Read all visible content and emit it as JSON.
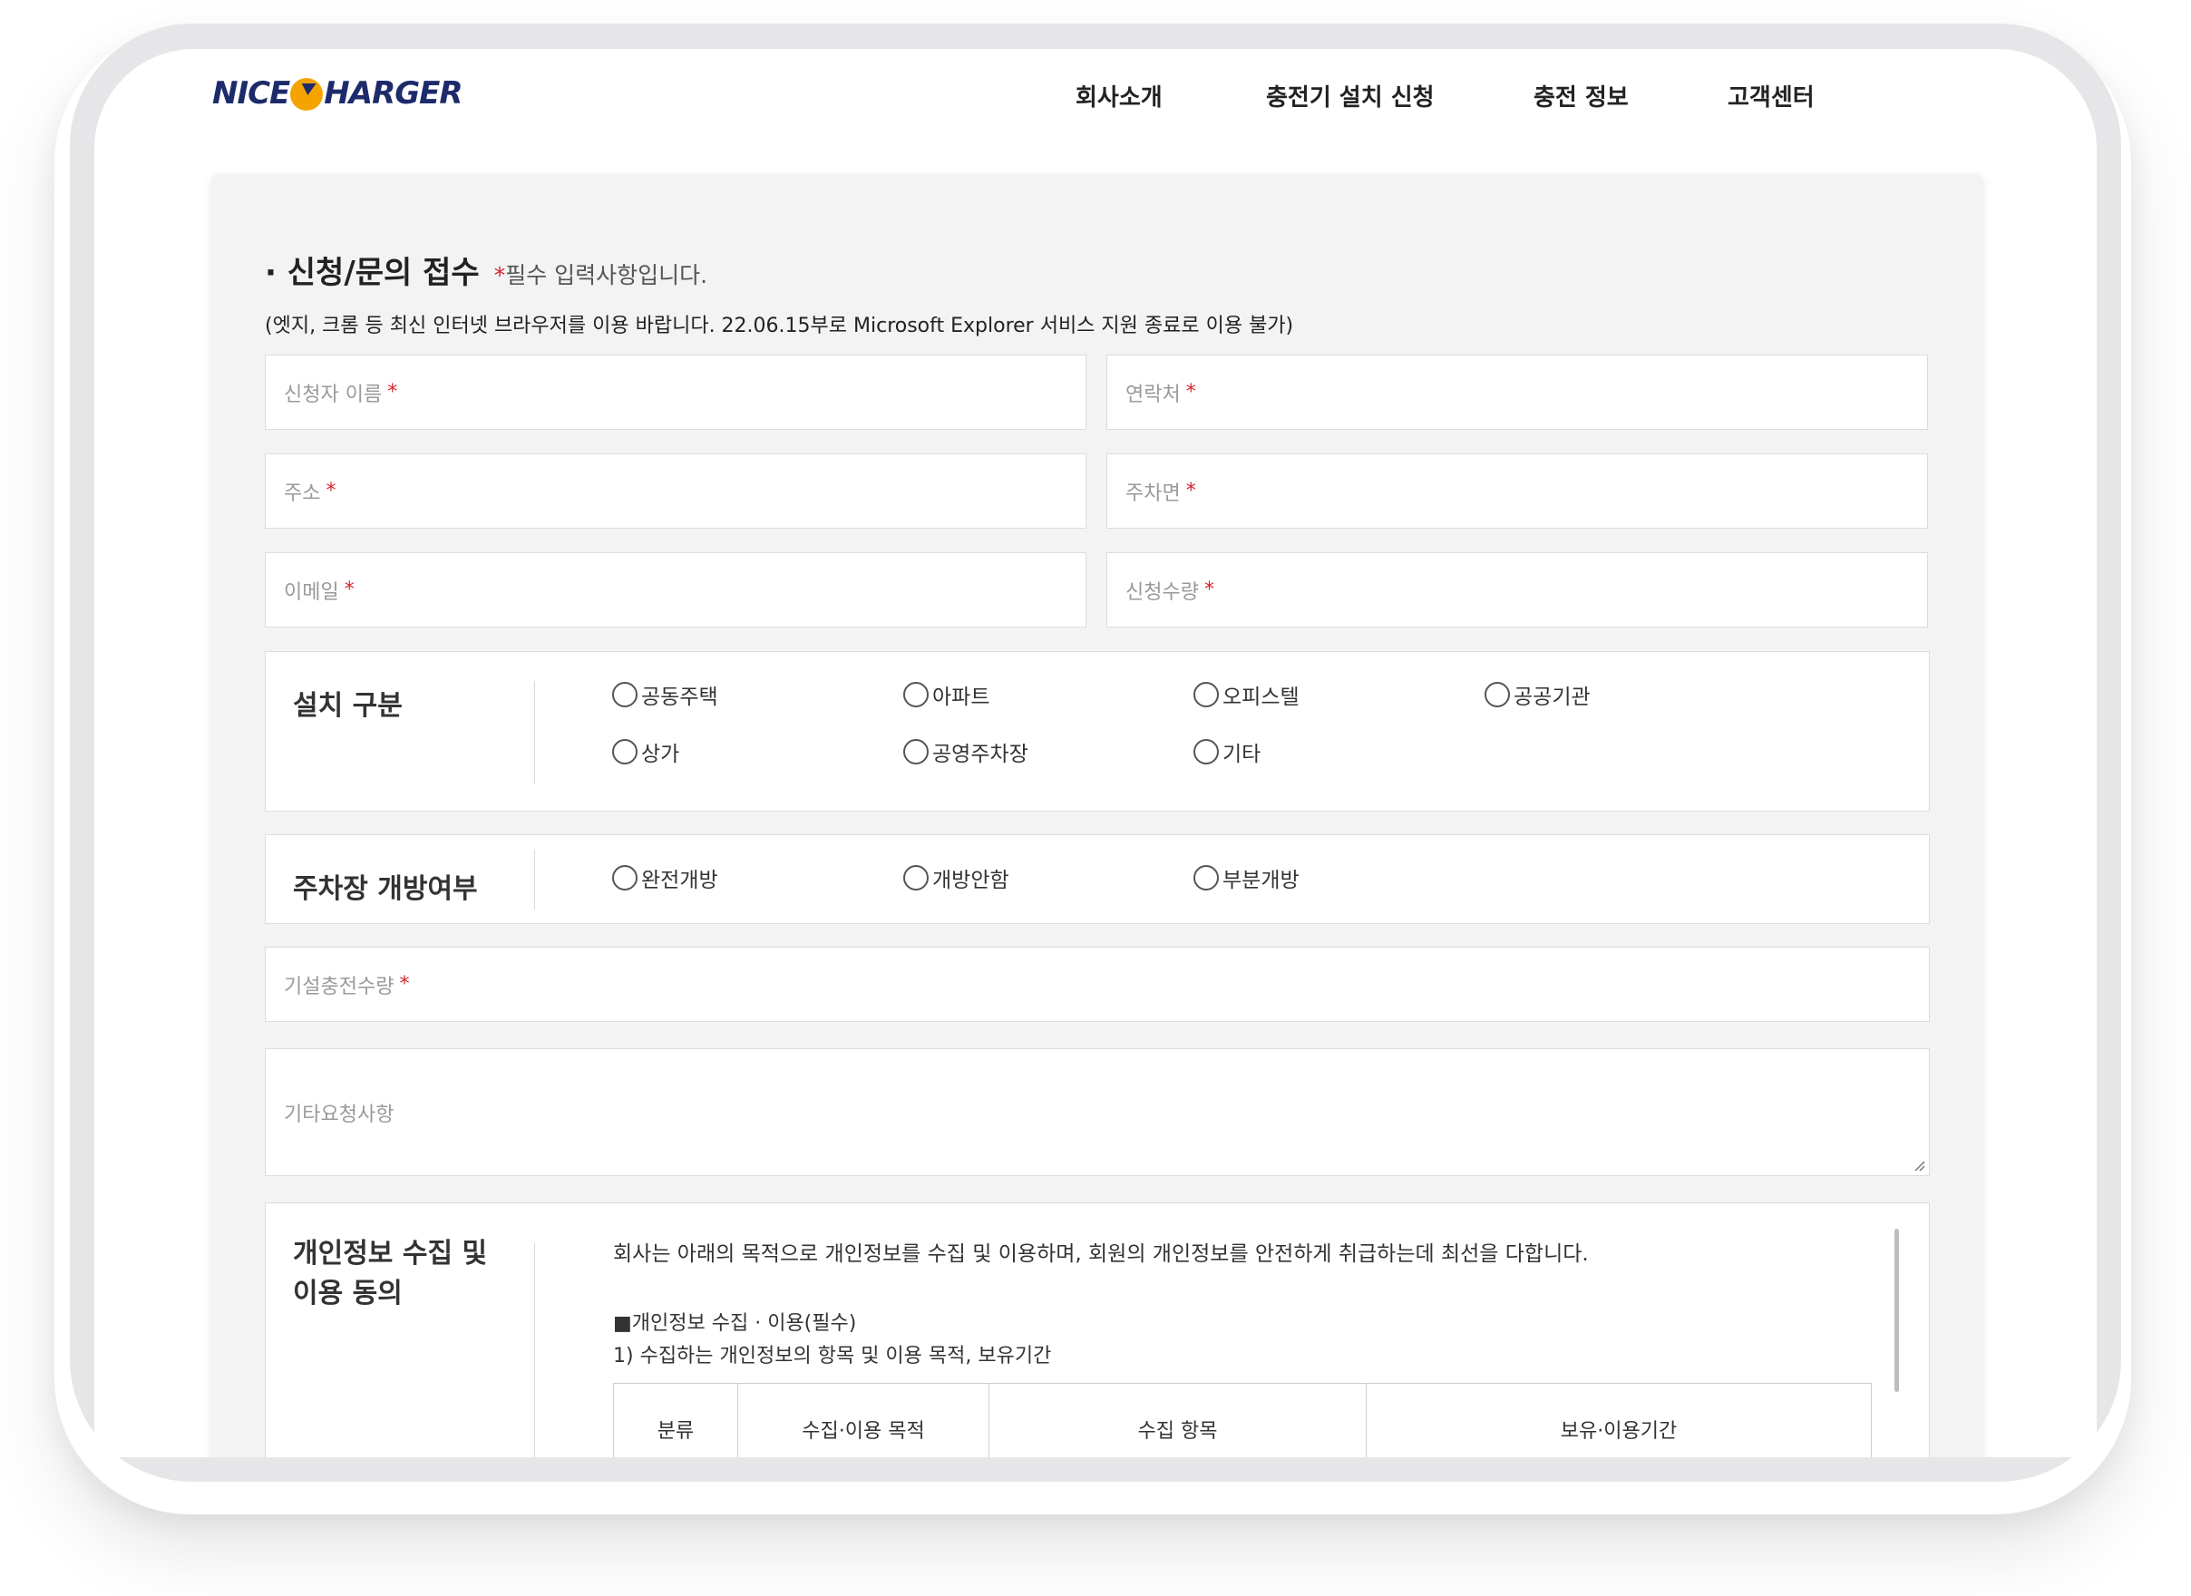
{
  "header": {
    "logo_left": "NICE",
    "logo_right": "HARGER",
    "nav": [
      "회사소개",
      "충전기 설치 신청",
      "충전 정보",
      "고객센터"
    ]
  },
  "form": {
    "title": "· 신청/문의 접수",
    "required_mark": "*",
    "required_note": "필수 입력사항입니다.",
    "notice": "(엣지, 크롬 등 최신 인터넷 브라우저를 이용 바랍니다. 22.06.15부로 Microsoft Explorer 서비스 지원 종료로 이용 불가)",
    "fields": {
      "name": "신청자 이름",
      "phone": "연락처",
      "address": "주소",
      "parking_spaces": "주차면",
      "email": "이메일",
      "quantity": "신청수량",
      "existing_chargers": "기설충전수량",
      "other_requests": "기타요청사항"
    },
    "install_type": {
      "label": "설치 구분",
      "options": [
        "공동주택",
        "아파트",
        "오피스텔",
        "공공기관",
        "상가",
        "공영주차장",
        "기타"
      ]
    },
    "parking_open": {
      "label": "주차장 개방여부",
      "options": [
        "완전개방",
        "개방안함",
        "부분개방"
      ]
    },
    "privacy": {
      "label_line1": "개인정보 수집 및",
      "label_line2": "이용 동의",
      "intro": "회사는 아래의 목적으로 개인정보를 수집 및 이용하며, 회원의 개인정보를 안전하게 취급하는데 최선을 다합니다.",
      "section_title": "■개인정보 수집 · 이용(필수)",
      "sub_title": "1) 수집하는 개인정보의 항목 및 이용 목적, 보유기간",
      "table_headers": [
        "분류",
        "수집·이용 목적",
        "수집 항목",
        "보유·이용기간"
      ]
    }
  },
  "colors": {
    "brand_navy": "#1d2b6b",
    "brand_orange": "#f5a300",
    "required_red": "#d9232d"
  }
}
